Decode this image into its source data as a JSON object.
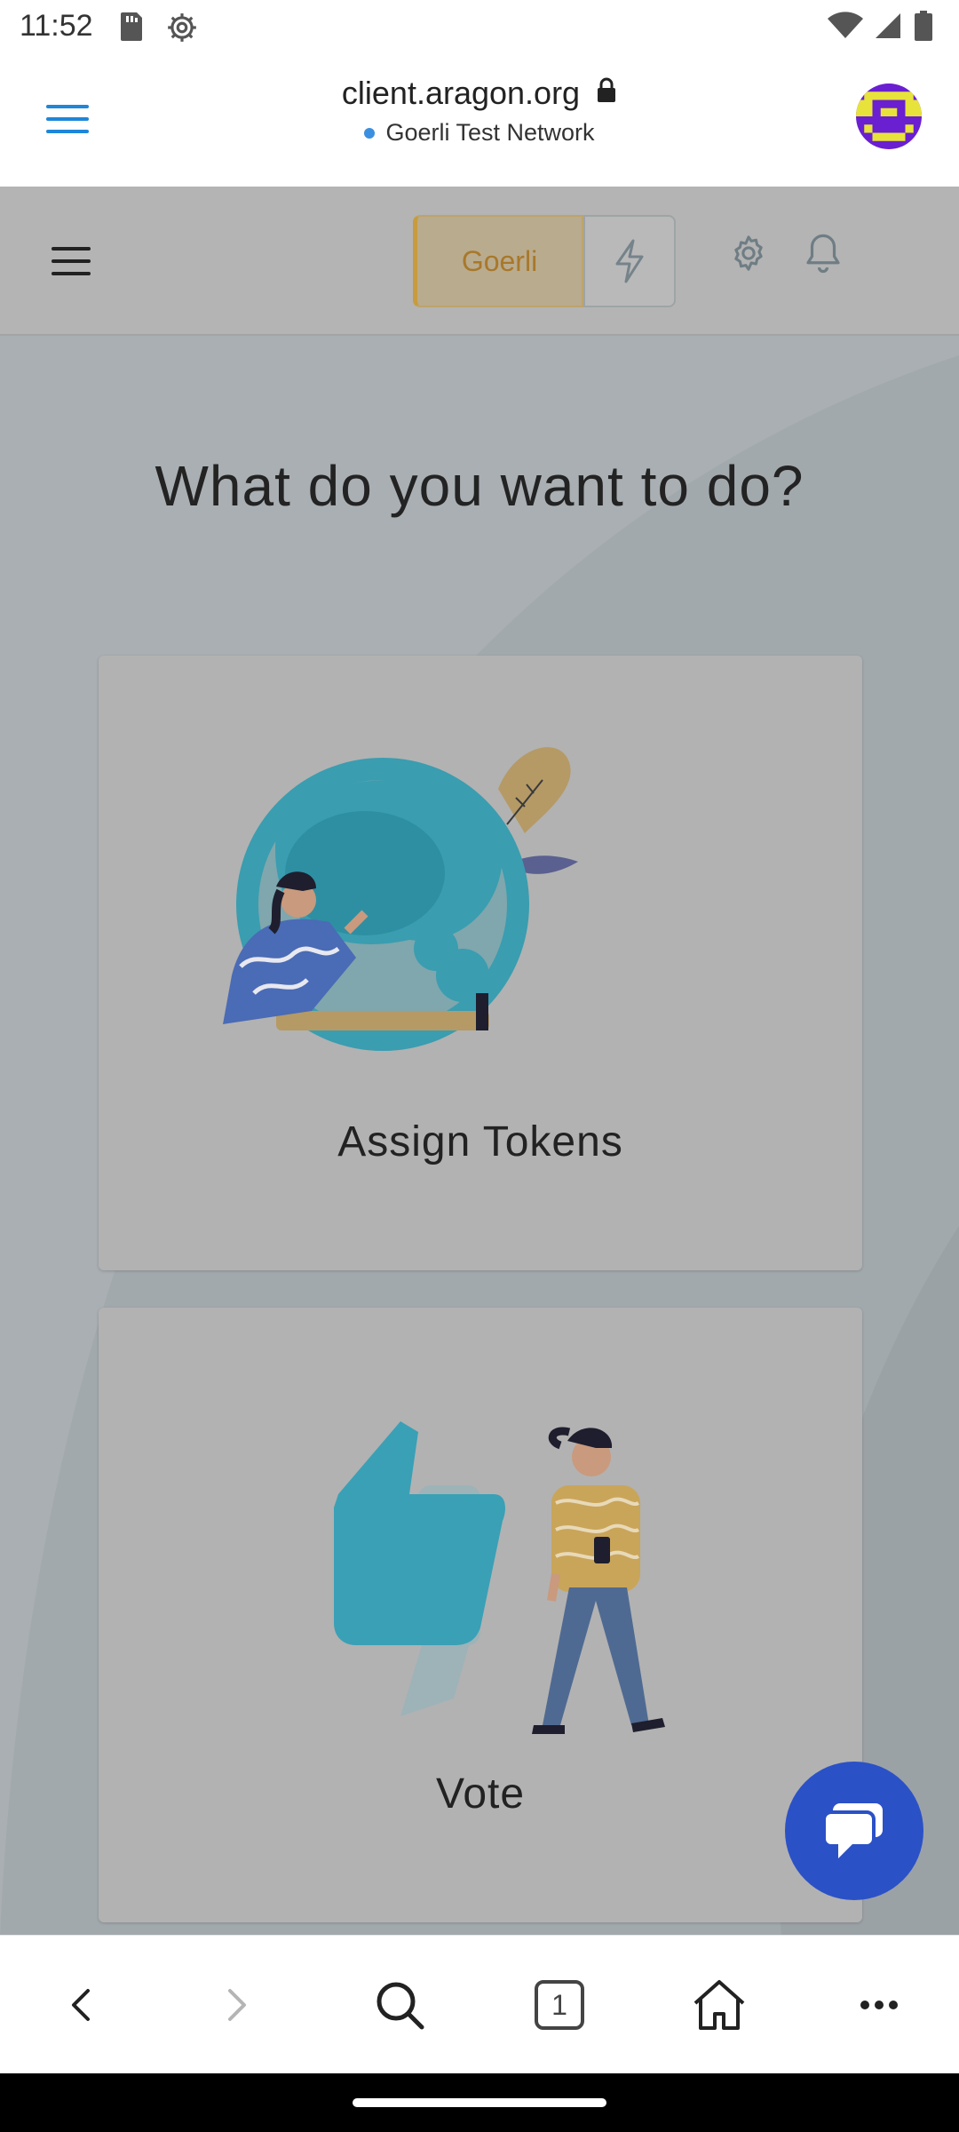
{
  "status_bar": {
    "time": "11:52",
    "icons": [
      "sd-card-icon",
      "settings-gear-icon",
      "wifi-icon",
      "cell-signal-icon",
      "battery-icon"
    ]
  },
  "browser": {
    "url": "client.aragon.org",
    "network_label": "Goerli Test Network",
    "menu_icon": "hamburger-menu-icon",
    "lock_icon": "lock-icon",
    "accent_color": "#1f86d8"
  },
  "app_header": {
    "network_button_label": "Goerli",
    "icons": [
      "hamburger-icon",
      "bolt-icon",
      "gear-icon",
      "bell-icon"
    ]
  },
  "main": {
    "headline": "What do you want to do?",
    "cards": [
      {
        "label": "Assign Tokens"
      },
      {
        "label": "Vote"
      }
    ]
  },
  "chat_button": {
    "icon": "chat-bubbles-icon",
    "color": "#2b51c7"
  },
  "bottom_nav": {
    "tab_count": "1",
    "icons": [
      "back-icon",
      "forward-icon",
      "search-icon",
      "tabs-icon",
      "home-icon",
      "more-icon"
    ]
  }
}
